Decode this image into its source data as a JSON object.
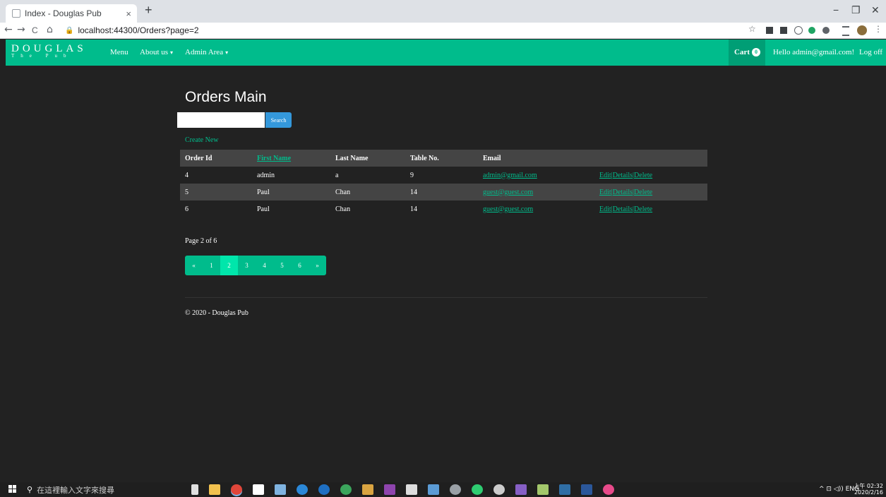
{
  "browser": {
    "tab_title": "Index - Douglas Pub",
    "tab_close": "×",
    "new_tab": "+",
    "url": "localhost:44300/Orders?page=2",
    "back": "←",
    "forward": "→",
    "reload": "C",
    "home": "⌂",
    "lock": "🔒",
    "star": "☆",
    "minimize": "−",
    "restore": "❐",
    "close": "✕"
  },
  "navbar": {
    "brand_main": "DOUGLAS",
    "brand_sub": "The Pub",
    "menu": "Menu",
    "about": "About us",
    "admin": "Admin Area",
    "caret": "▾",
    "cart": "Cart",
    "cart_count": "0",
    "hello": "Hello admin@gmail.com!",
    "logoff": "Log off"
  },
  "main": {
    "title": "Orders Main",
    "search_value": "",
    "search_button": "Search",
    "create_new": "Create New",
    "headers": {
      "order_id": "Order Id",
      "first_name": "First Name",
      "last_name": "Last Name",
      "table_no": "Table No.",
      "email": "Email",
      "actions": ""
    },
    "rows": [
      {
        "order_id": "4",
        "first_name": "admin",
        "last_name": "a",
        "table_no": "9",
        "email": "admin@gmail.com",
        "edit": "Edit",
        "details": "Details",
        "delete": "Delete",
        "sep": "|"
      },
      {
        "order_id": "5",
        "first_name": "Paul",
        "last_name": "Chan",
        "table_no": "14",
        "email": "guest@guest.com",
        "edit": "Edit",
        "details": "Details",
        "delete": "Delete",
        "sep": "|"
      },
      {
        "order_id": "6",
        "first_name": "Paul",
        "last_name": "Chan",
        "table_no": "14",
        "email": "guest@guest.com",
        "edit": "Edit",
        "details": "Details",
        "delete": "Delete",
        "sep": "|"
      }
    ],
    "page_info": "Page 2 of 6",
    "pager": {
      "prev": "«",
      "p1": "1",
      "p2": "2",
      "p3": "3",
      "p4": "4",
      "p5": "5",
      "p6": "6",
      "next": "»",
      "active": 2
    },
    "footer": "© 2020 - Douglas Pub"
  },
  "taskbar": {
    "search_placeholder": "在這裡輸入文字來搜尋",
    "search_icon": "⚲",
    "tray": "^  ⊡  ◁))  ENG",
    "time": "上午 02:32",
    "date": "2020/2/16"
  }
}
